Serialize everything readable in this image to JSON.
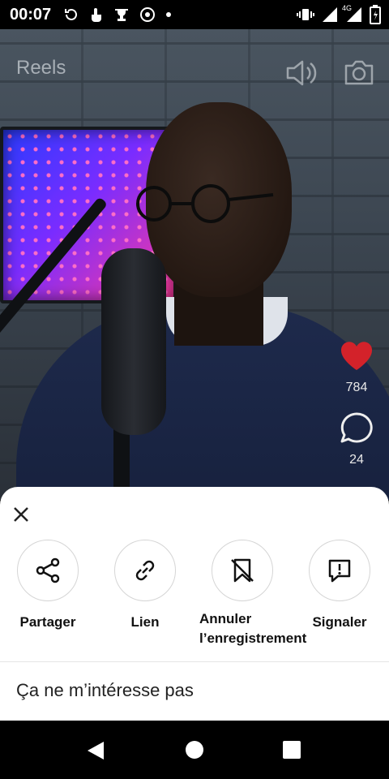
{
  "status_bar": {
    "time": "00:07",
    "network": "4G"
  },
  "reel": {
    "title": "Reels",
    "likes": "784",
    "comments": "24"
  },
  "sheet": {
    "actions": [
      {
        "label": "Partager",
        "icon": "share-icon"
      },
      {
        "label": "Lien",
        "icon": "link-icon"
      },
      {
        "label": "Annuler l’enregistrement",
        "icon": "bookmark-remove-icon"
      },
      {
        "label": "Signaler",
        "icon": "report-icon"
      }
    ],
    "not_interested": "Ça ne m’intéresse pas"
  },
  "colors": {
    "like": "#d3222a",
    "sheet_bg": "#ffffff"
  }
}
